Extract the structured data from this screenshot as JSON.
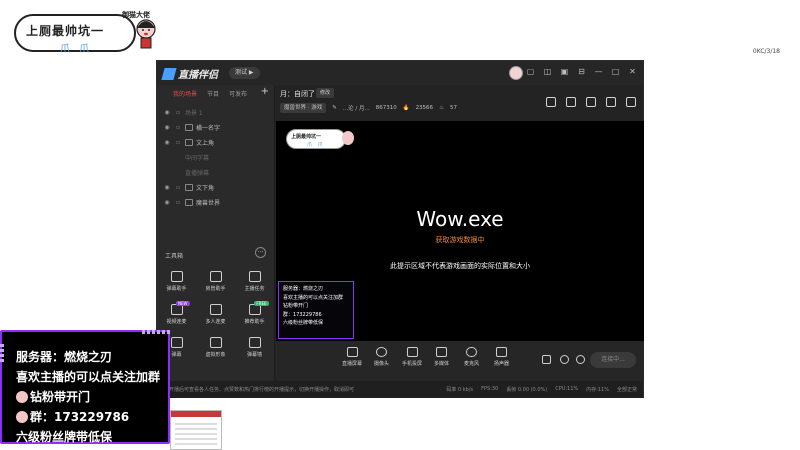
{
  "banner": {
    "text": "上厕最帅坑一",
    "side": "御猫大佬",
    "deco": "爪 爪"
  },
  "top_right_tag": "0KC/3/18",
  "app": {
    "title": "直播伴侣",
    "version": "测试 ▶",
    "window_buttons": [
      "▢",
      "◫",
      "▣",
      "⊟",
      "—",
      "□",
      "✕"
    ]
  },
  "left_panel": {
    "tabs": [
      "我的场景",
      "节目",
      "可发布"
    ],
    "scenes": [
      {
        "label": "场景 1",
        "dim": true,
        "has_icon": false
      },
      {
        "label": "横一名字",
        "dim": false,
        "has_icon": true
      },
      {
        "label": "文上角",
        "dim": false,
        "has_icon": true
      },
      {
        "label": "中间字幕",
        "dim": true,
        "has_icon": false
      },
      {
        "label": "直播弹幕",
        "dim": true,
        "has_icon": false
      },
      {
        "label": "文下角",
        "dim": false,
        "has_icon": true
      },
      {
        "label": "魔兽世界",
        "dim": false,
        "has_icon": true
      }
    ],
    "tools_header": "工具箱",
    "tools": [
      {
        "label": "弹幕助手",
        "badge": ""
      },
      {
        "label": "房管助手",
        "badge": ""
      },
      {
        "label": "主播任务",
        "badge": ""
      },
      {
        "label": "视频连麦",
        "badge": "NEW"
      },
      {
        "label": "多人连麦",
        "badge": ""
      },
      {
        "label": "推荐助手",
        "badge": "FREE"
      },
      {
        "label": "弹幕",
        "badge": ""
      },
      {
        "label": "虚拟形象",
        "badge": ""
      },
      {
        "label": "弹幕墙",
        "badge": ""
      }
    ]
  },
  "center": {
    "room_title": "月：自闭了",
    "edit_label": "修改",
    "category": "魔兽世界 · 游戏",
    "name": "...沦 / 月...",
    "room_id": "867310",
    "fans": "23566",
    "online": "57",
    "game_title": "Wow.exe",
    "game_status": "获取游戏数据中",
    "game_note": "此提示区域不代表游戏画面的实际位置和大小"
  },
  "mini_card": {
    "lines": [
      "服务器：燃烧之刃",
      "喜欢主播的可以点关注加群",
      "钻粉带开门",
      "群：173229786",
      "六级粉丝牌带低保"
    ]
  },
  "toolbar": {
    "items": [
      "直播屏幕",
      "摄像头",
      "手机投屏",
      "多媒体",
      "麦克风",
      "扬声器"
    ],
    "live_label": "连接中..."
  },
  "statusbar": {
    "tip": "开播后可查看各人任务、点赞数和热门排行榜的开播提示，切换开播操作，取消即可",
    "stats": [
      "码率 0 kb/s",
      "FPS:30",
      "丢帧 0.00 (0.0%)",
      "CPU:11%",
      "内存:11%",
      "全部正常"
    ]
  },
  "overlay": {
    "lines": [
      "服务器：燃烧之刃",
      "喜欢主播的可以点关注加群",
      "钻粉带开门",
      "群：173229786",
      "六级粉丝牌带低保"
    ]
  }
}
